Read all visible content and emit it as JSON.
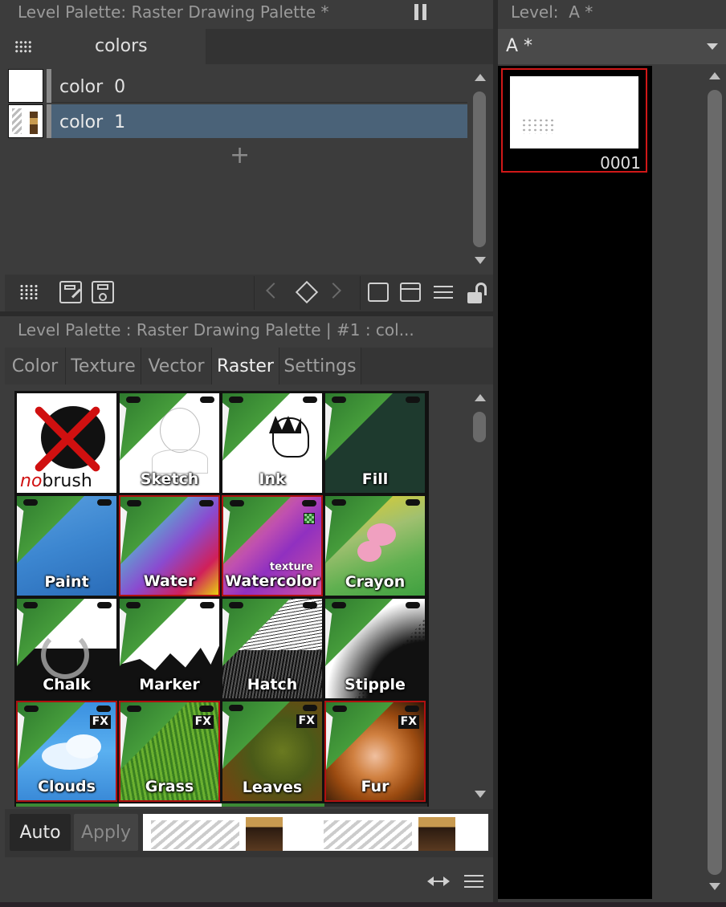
{
  "level_palette": {
    "title": "Level Palette: Raster Drawing Palette *",
    "page_tab": "colors",
    "styles": [
      {
        "name": "color_0",
        "label": "color  0"
      },
      {
        "name": "color_1",
        "label": "color  1"
      }
    ],
    "add_symbol": "+"
  },
  "style_editor": {
    "title": "Level Palette : Raster Drawing Palette | #1 : col...",
    "tabs": [
      "Color",
      "Texture",
      "Vector",
      "Raster",
      "Settings"
    ],
    "active_tab": "Raster",
    "brushes": [
      {
        "name": "nobrush",
        "label": "brush",
        "label_prefix": "no"
      },
      {
        "name": "sketch",
        "label": "Sketch"
      },
      {
        "name": "ink",
        "label": "Ink"
      },
      {
        "name": "fill",
        "label": "Fill"
      },
      {
        "name": "paint",
        "label": "Paint"
      },
      {
        "name": "water",
        "label": "Water"
      },
      {
        "name": "watercolor",
        "label": "Watercolor",
        "sublabel": "texture"
      },
      {
        "name": "crayon",
        "label": "Crayon"
      },
      {
        "name": "chalk",
        "label": "Chalk"
      },
      {
        "name": "marker",
        "label": "Marker"
      },
      {
        "name": "hatch",
        "label": "Hatch"
      },
      {
        "name": "stipple",
        "label": "Stipple"
      },
      {
        "name": "clouds",
        "label": "Clouds",
        "badge": "FX"
      },
      {
        "name": "grass",
        "label": "Grass",
        "badge": "FX"
      },
      {
        "name": "leaves",
        "label": "Leaves",
        "badge": "FX"
      },
      {
        "name": "fur",
        "label": "Fur",
        "badge": "FX"
      }
    ],
    "auto_label": "Auto",
    "apply_label": "Apply"
  },
  "level_strip": {
    "title": "Level:  A *",
    "level_select": "A *",
    "frame_number": "0001"
  },
  "colors": {
    "panel_bg": "#3c3c3c",
    "selected_row": "#4a6278",
    "frame_red": "#d01818",
    "brush_green": "#4ba43e"
  }
}
